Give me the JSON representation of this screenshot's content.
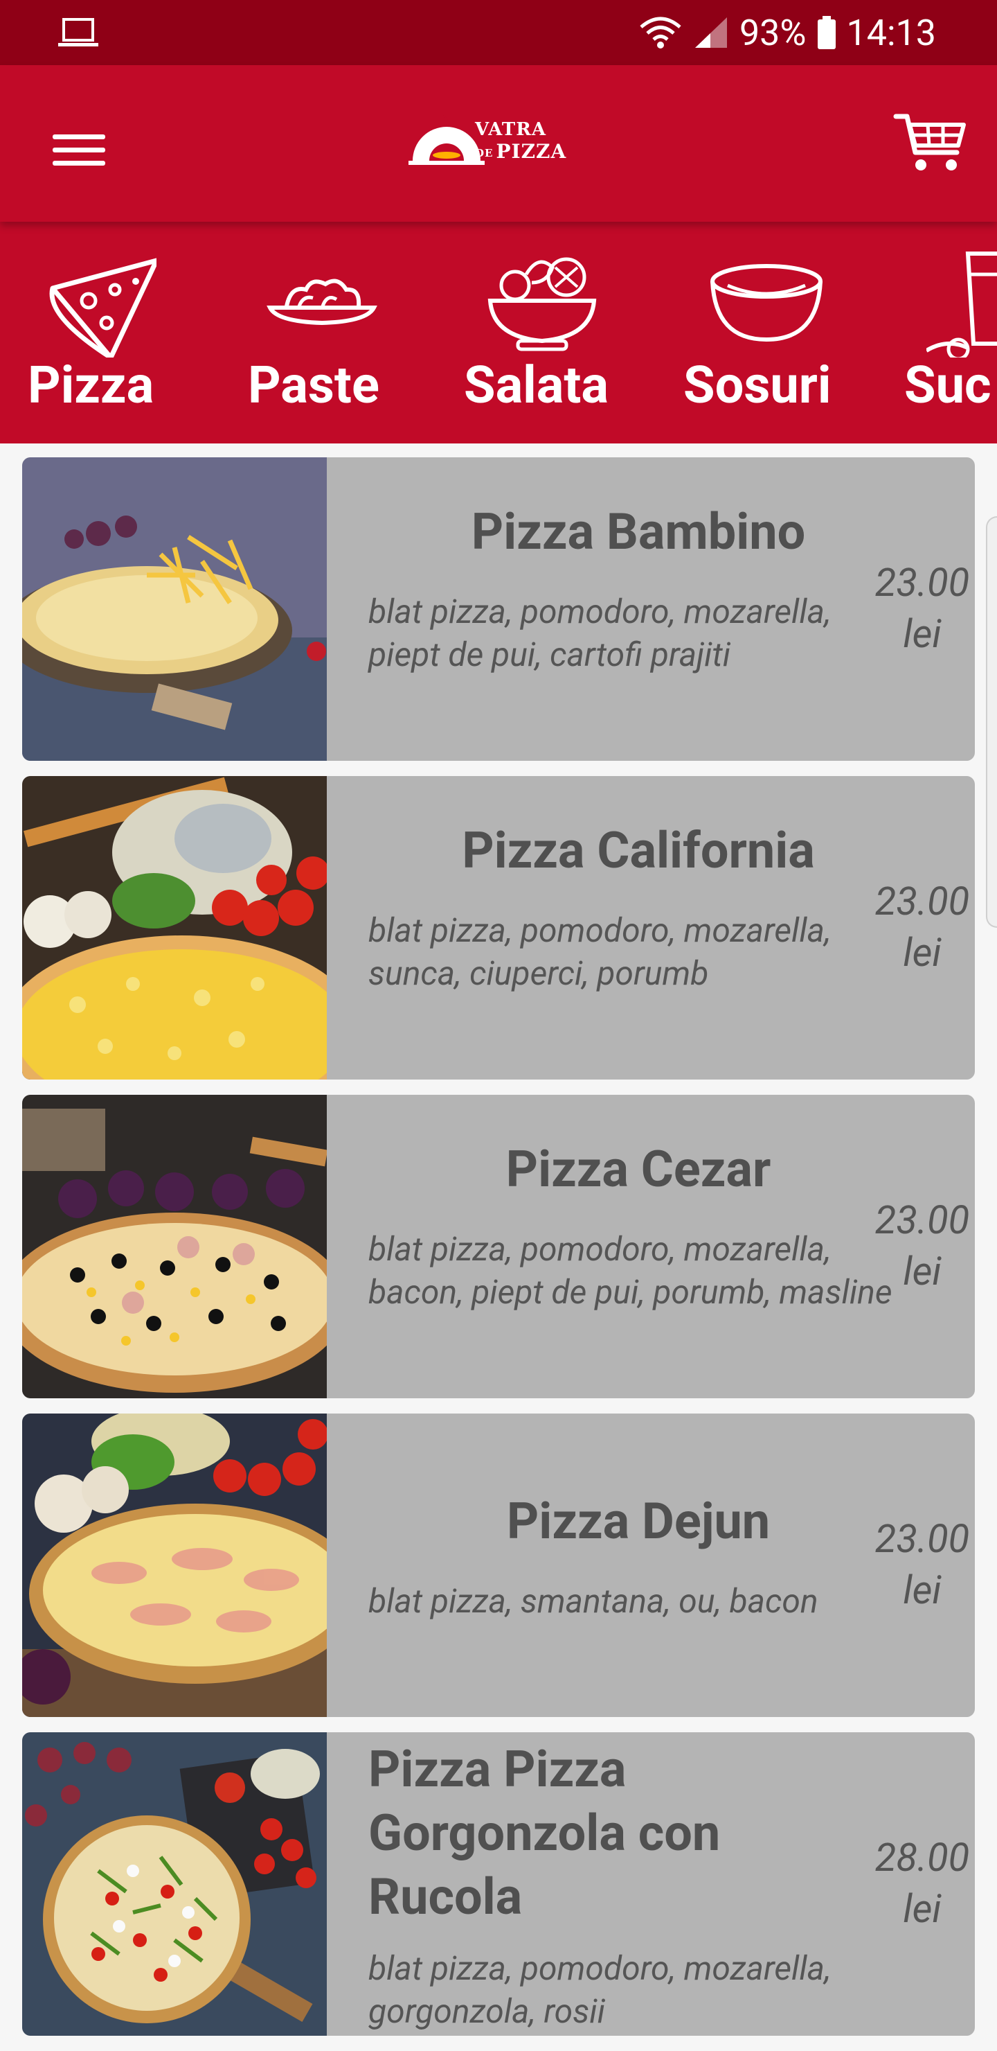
{
  "status_bar": {
    "battery": "93%",
    "time": "14:13"
  },
  "app_bar": {
    "logo_line1": "VATRA",
    "logo_small": "DE",
    "logo_line2": "PIZZA"
  },
  "categories": [
    {
      "label": "Pizza",
      "icon": "pizza-slice-icon"
    },
    {
      "label": "Paste",
      "icon": "pasta-plate-icon"
    },
    {
      "label": "Salata",
      "icon": "salad-bowl-icon"
    },
    {
      "label": "Sosuri",
      "icon": "sauce-bowl-icon"
    },
    {
      "label": "Suc",
      "icon": "juice-glass-icon"
    }
  ],
  "products": [
    {
      "name": "Pizza Bambino",
      "description": "blat pizza, pomodoro, mozarella, piept de pui, cartofi prajiti",
      "price_value": "23.00",
      "price_unit": "lei"
    },
    {
      "name": "Pizza California",
      "description": "blat pizza, pomodoro, mozarella, sunca, ciuperci, porumb",
      "price_value": "23.00",
      "price_unit": "lei"
    },
    {
      "name": "Pizza Cezar",
      "description": "blat pizza, pomodoro, mozarella, bacon, piept de pui, porumb, masline",
      "price_value": "23.00",
      "price_unit": "lei"
    },
    {
      "name": "Pizza Dejun",
      "description": "blat pizza, smantana, ou, bacon",
      "price_value": "23.00",
      "price_unit": "lei"
    },
    {
      "name": "Pizza Pizza Gorgonzola con Rucola",
      "description": "blat pizza, pomodoro, mozarella, gorgonzola, rosii",
      "price_value": "28.00",
      "price_unit": "lei"
    }
  ],
  "colors": {
    "status_bar": "#8f0016",
    "brand_red": "#c10a28",
    "card_bg": "#b4b4b4",
    "text_dark": "#505050"
  }
}
